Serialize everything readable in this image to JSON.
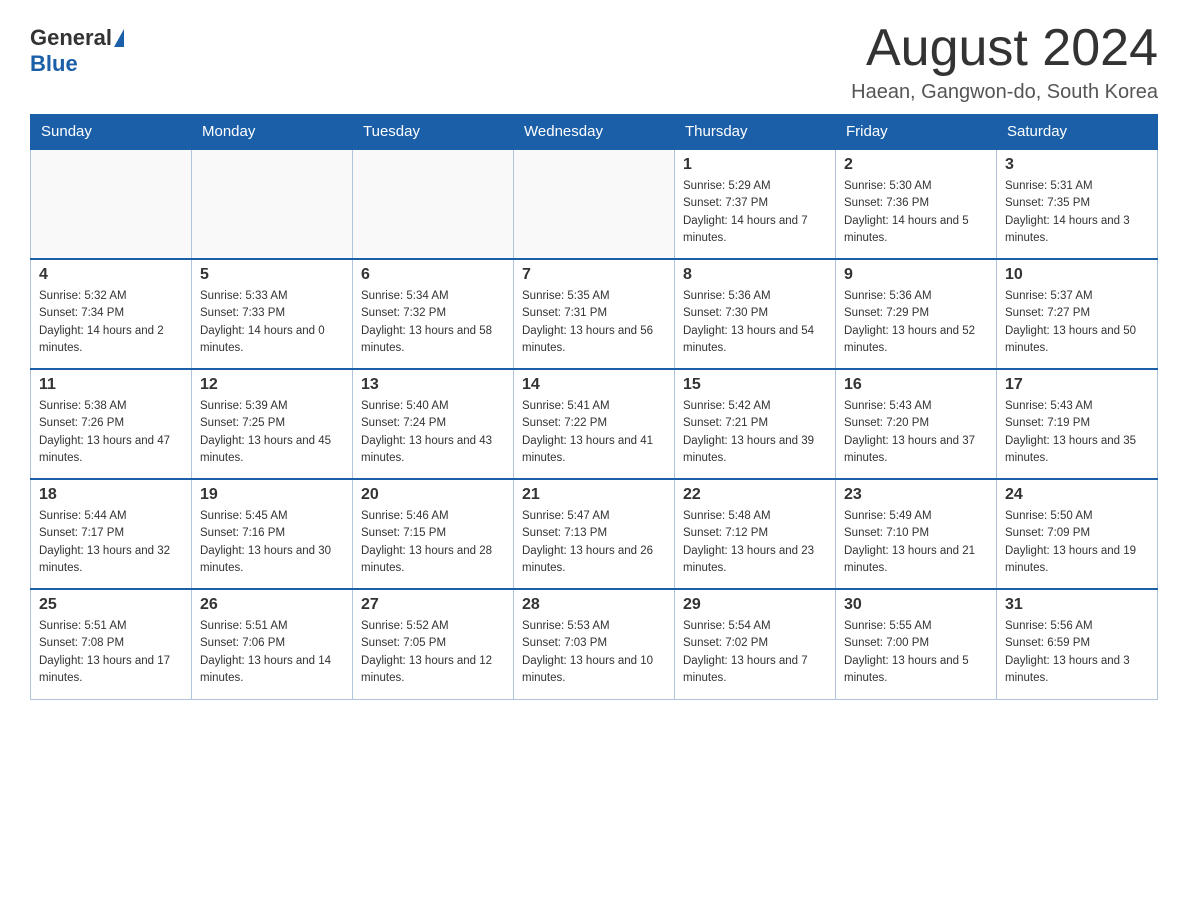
{
  "logo": {
    "general": "General",
    "blue": "Blue"
  },
  "title": "August 2024",
  "subtitle": "Haean, Gangwon-do, South Korea",
  "weekdays": [
    "Sunday",
    "Monday",
    "Tuesday",
    "Wednesday",
    "Thursday",
    "Friday",
    "Saturday"
  ],
  "weeks": [
    [
      {
        "day": "",
        "info": ""
      },
      {
        "day": "",
        "info": ""
      },
      {
        "day": "",
        "info": ""
      },
      {
        "day": "",
        "info": ""
      },
      {
        "day": "1",
        "info": "Sunrise: 5:29 AM\nSunset: 7:37 PM\nDaylight: 14 hours and 7 minutes."
      },
      {
        "day": "2",
        "info": "Sunrise: 5:30 AM\nSunset: 7:36 PM\nDaylight: 14 hours and 5 minutes."
      },
      {
        "day": "3",
        "info": "Sunrise: 5:31 AM\nSunset: 7:35 PM\nDaylight: 14 hours and 3 minutes."
      }
    ],
    [
      {
        "day": "4",
        "info": "Sunrise: 5:32 AM\nSunset: 7:34 PM\nDaylight: 14 hours and 2 minutes."
      },
      {
        "day": "5",
        "info": "Sunrise: 5:33 AM\nSunset: 7:33 PM\nDaylight: 14 hours and 0 minutes."
      },
      {
        "day": "6",
        "info": "Sunrise: 5:34 AM\nSunset: 7:32 PM\nDaylight: 13 hours and 58 minutes."
      },
      {
        "day": "7",
        "info": "Sunrise: 5:35 AM\nSunset: 7:31 PM\nDaylight: 13 hours and 56 minutes."
      },
      {
        "day": "8",
        "info": "Sunrise: 5:36 AM\nSunset: 7:30 PM\nDaylight: 13 hours and 54 minutes."
      },
      {
        "day": "9",
        "info": "Sunrise: 5:36 AM\nSunset: 7:29 PM\nDaylight: 13 hours and 52 minutes."
      },
      {
        "day": "10",
        "info": "Sunrise: 5:37 AM\nSunset: 7:27 PM\nDaylight: 13 hours and 50 minutes."
      }
    ],
    [
      {
        "day": "11",
        "info": "Sunrise: 5:38 AM\nSunset: 7:26 PM\nDaylight: 13 hours and 47 minutes."
      },
      {
        "day": "12",
        "info": "Sunrise: 5:39 AM\nSunset: 7:25 PM\nDaylight: 13 hours and 45 minutes."
      },
      {
        "day": "13",
        "info": "Sunrise: 5:40 AM\nSunset: 7:24 PM\nDaylight: 13 hours and 43 minutes."
      },
      {
        "day": "14",
        "info": "Sunrise: 5:41 AM\nSunset: 7:22 PM\nDaylight: 13 hours and 41 minutes."
      },
      {
        "day": "15",
        "info": "Sunrise: 5:42 AM\nSunset: 7:21 PM\nDaylight: 13 hours and 39 minutes."
      },
      {
        "day": "16",
        "info": "Sunrise: 5:43 AM\nSunset: 7:20 PM\nDaylight: 13 hours and 37 minutes."
      },
      {
        "day": "17",
        "info": "Sunrise: 5:43 AM\nSunset: 7:19 PM\nDaylight: 13 hours and 35 minutes."
      }
    ],
    [
      {
        "day": "18",
        "info": "Sunrise: 5:44 AM\nSunset: 7:17 PM\nDaylight: 13 hours and 32 minutes."
      },
      {
        "day": "19",
        "info": "Sunrise: 5:45 AM\nSunset: 7:16 PM\nDaylight: 13 hours and 30 minutes."
      },
      {
        "day": "20",
        "info": "Sunrise: 5:46 AM\nSunset: 7:15 PM\nDaylight: 13 hours and 28 minutes."
      },
      {
        "day": "21",
        "info": "Sunrise: 5:47 AM\nSunset: 7:13 PM\nDaylight: 13 hours and 26 minutes."
      },
      {
        "day": "22",
        "info": "Sunrise: 5:48 AM\nSunset: 7:12 PM\nDaylight: 13 hours and 23 minutes."
      },
      {
        "day": "23",
        "info": "Sunrise: 5:49 AM\nSunset: 7:10 PM\nDaylight: 13 hours and 21 minutes."
      },
      {
        "day": "24",
        "info": "Sunrise: 5:50 AM\nSunset: 7:09 PM\nDaylight: 13 hours and 19 minutes."
      }
    ],
    [
      {
        "day": "25",
        "info": "Sunrise: 5:51 AM\nSunset: 7:08 PM\nDaylight: 13 hours and 17 minutes."
      },
      {
        "day": "26",
        "info": "Sunrise: 5:51 AM\nSunset: 7:06 PM\nDaylight: 13 hours and 14 minutes."
      },
      {
        "day": "27",
        "info": "Sunrise: 5:52 AM\nSunset: 7:05 PM\nDaylight: 13 hours and 12 minutes."
      },
      {
        "day": "28",
        "info": "Sunrise: 5:53 AM\nSunset: 7:03 PM\nDaylight: 13 hours and 10 minutes."
      },
      {
        "day": "29",
        "info": "Sunrise: 5:54 AM\nSunset: 7:02 PM\nDaylight: 13 hours and 7 minutes."
      },
      {
        "day": "30",
        "info": "Sunrise: 5:55 AM\nSunset: 7:00 PM\nDaylight: 13 hours and 5 minutes."
      },
      {
        "day": "31",
        "info": "Sunrise: 5:56 AM\nSunset: 6:59 PM\nDaylight: 13 hours and 3 minutes."
      }
    ]
  ]
}
